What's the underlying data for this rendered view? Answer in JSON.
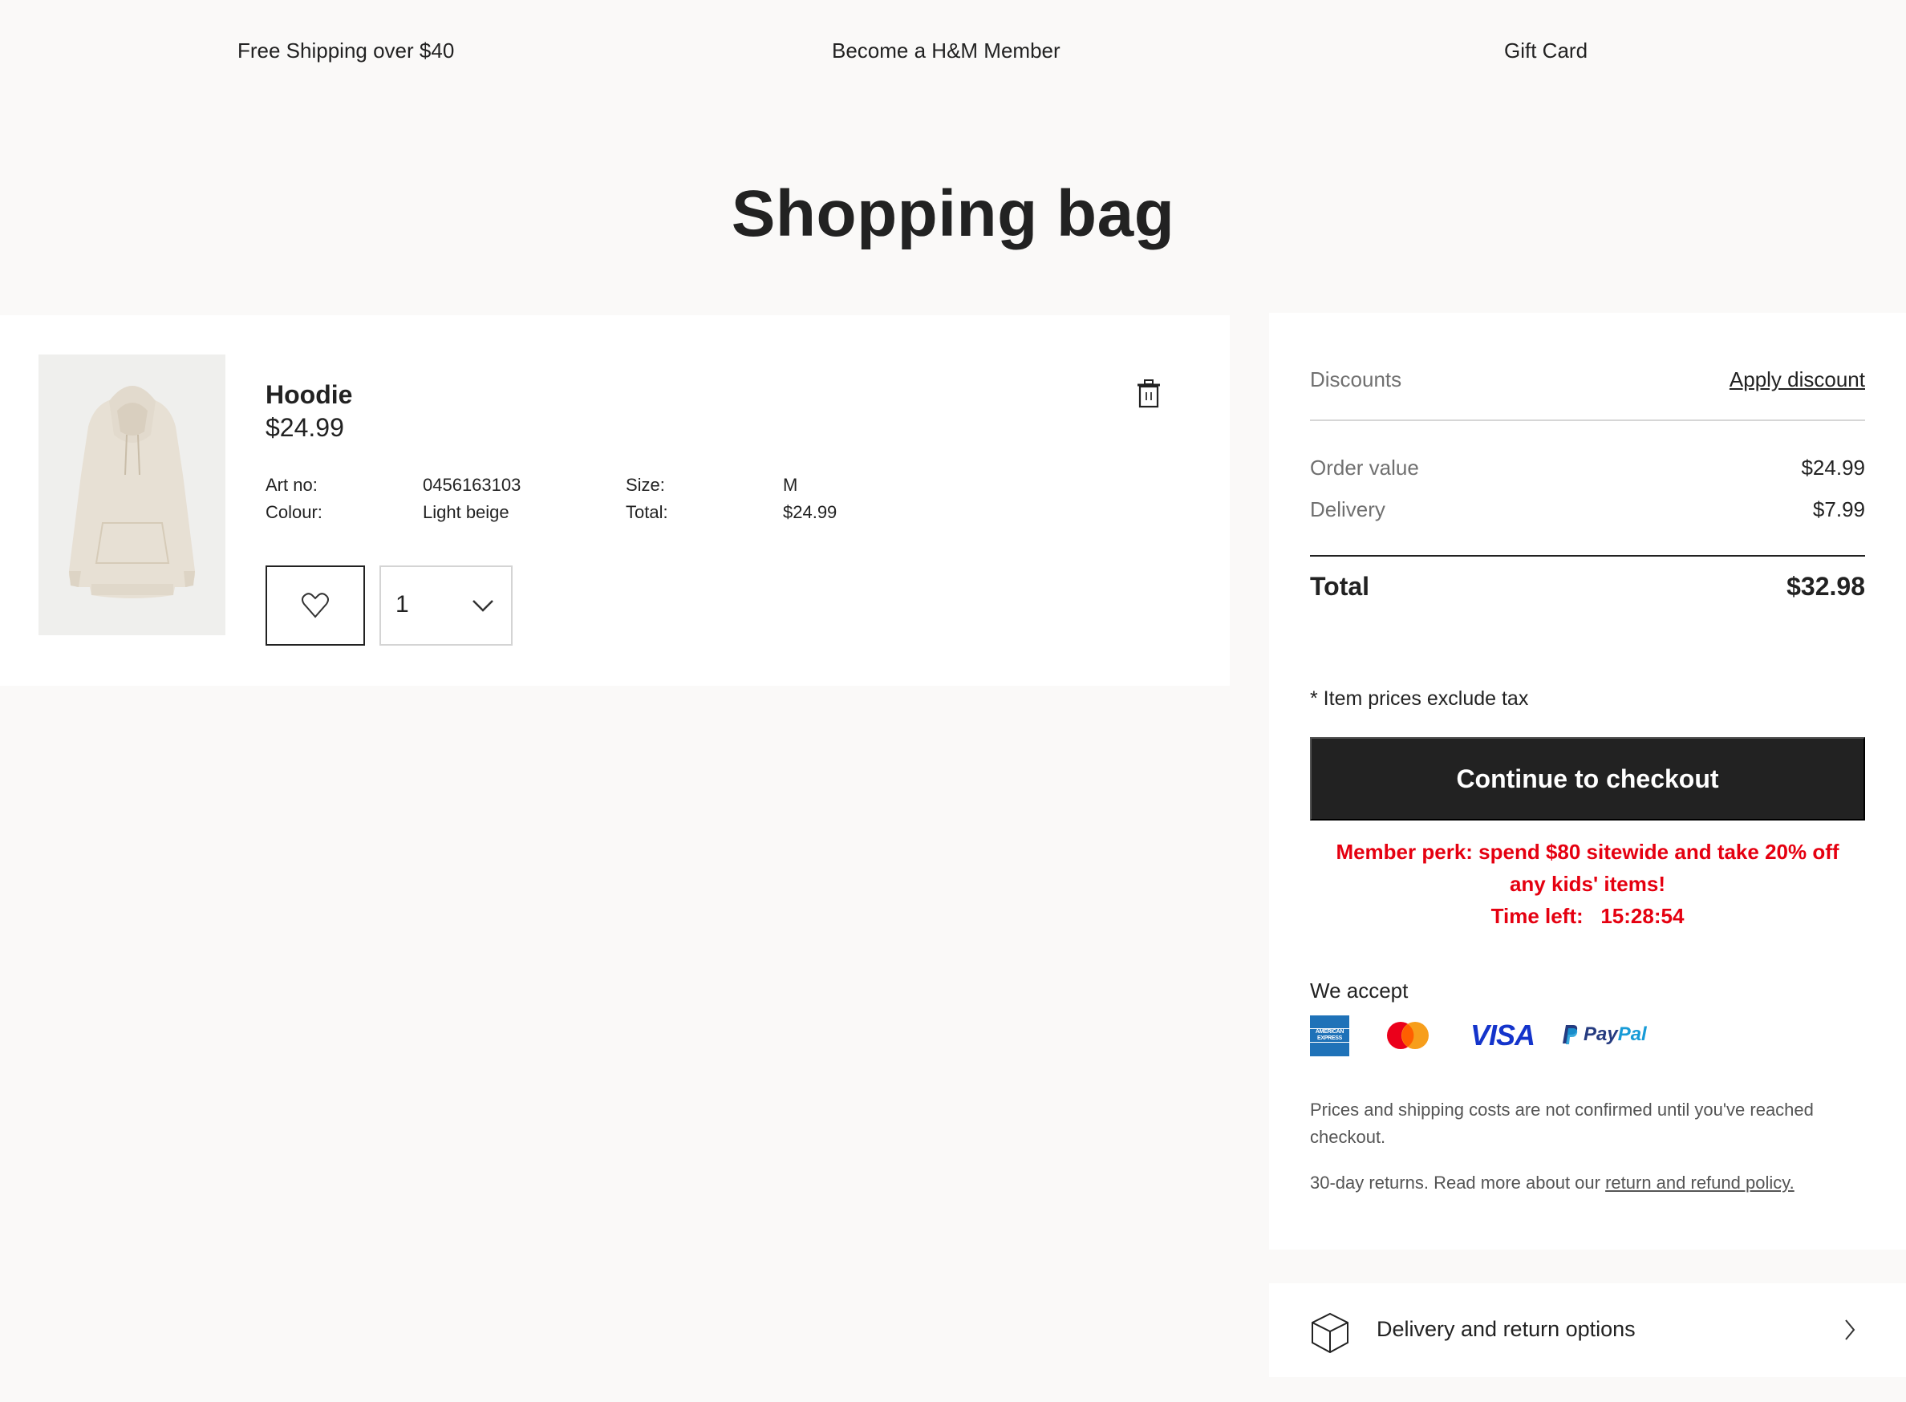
{
  "promo_bar": {
    "items": [
      {
        "label": "Free Shipping over $40"
      },
      {
        "label": "Become a H&M Member"
      },
      {
        "label": "Gift Card"
      }
    ]
  },
  "page": {
    "title": "Shopping bag"
  },
  "bag": {
    "items": [
      {
        "name": "Hoodie",
        "price": "$24.99",
        "image_icon": "hoodie-product-photo",
        "details": {
          "art_no_label": "Art no:",
          "art_no": "0456163103",
          "colour_label": "Colour:",
          "colour": "Light beige",
          "size_label": "Size:",
          "size": "M",
          "total_label": "Total:",
          "total": "$24.99"
        },
        "quantity": "1",
        "delete_icon": "trash-icon",
        "favorite_icon": "heart-icon",
        "quantity_icon": "chevron-down-icon"
      }
    ]
  },
  "summary": {
    "discounts_label": "Discounts",
    "apply_discount_link": "Apply discount",
    "order_value_label": "Order value",
    "order_value": "$24.99",
    "delivery_label": "Delivery",
    "delivery_value": "$7.99",
    "total_label": "Total",
    "total_value": "$32.98",
    "tax_note": "* Item prices exclude tax",
    "checkout_button": "Continue to checkout",
    "member_perk_line1": "Member perk: spend $80 sitewide and take 20% off",
    "member_perk_line2": "any kids' items!",
    "timer_label": "Time left:",
    "timer_value": "15:28:54",
    "we_accept_label": "We accept",
    "payment_methods": [
      {
        "name": "American Express",
        "icon": "amex-icon",
        "text": "AMERICAN EXPRESS"
      },
      {
        "name": "Mastercard",
        "icon": "mastercard-icon"
      },
      {
        "name": "Visa",
        "icon": "visa-icon",
        "text": "VISA"
      },
      {
        "name": "PayPal",
        "icon": "paypal-icon",
        "text_a": "Pay",
        "text_b": "Pal"
      }
    ],
    "prices_note": "Prices and shipping costs are not confirmed until you've reached checkout.",
    "returns_note": "30-day returns. Read more about our ",
    "returns_link": "return and refund policy."
  },
  "delivery_options": {
    "label": "Delivery and return options",
    "icon": "box-icon",
    "chevron_icon": "chevron-right-icon"
  },
  "colors": {
    "background": "#faf9f8",
    "card": "#ffffff",
    "text": "#222222",
    "muted": "#707070",
    "accent_red": "#e50010",
    "button_dark": "#222222"
  }
}
